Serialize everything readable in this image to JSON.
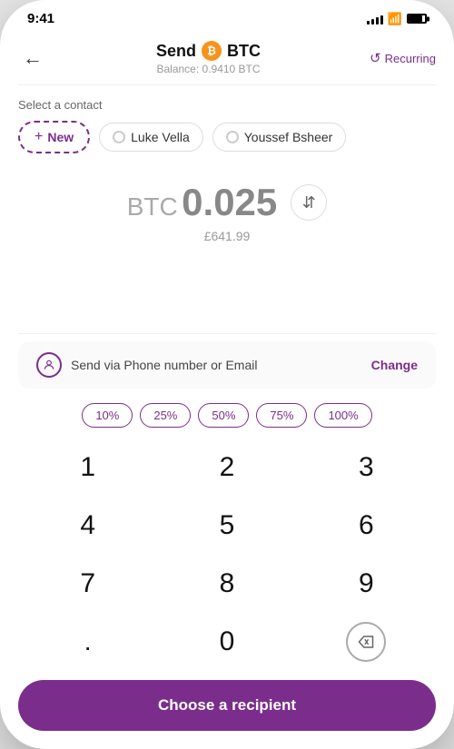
{
  "statusBar": {
    "time": "9:41"
  },
  "header": {
    "title": "Send",
    "currency": "BTC",
    "balance": "Balance: 0.9410 BTC",
    "recurringLabel": "Recurring"
  },
  "contacts": {
    "sectionLabel": "Select a contact",
    "newLabel": "New",
    "items": [
      {
        "name": "Luke Vella"
      },
      {
        "name": "Youssef Bsheer"
      }
    ]
  },
  "amount": {
    "currency": "BTC",
    "value": "0.025",
    "fiat": "£641.99"
  },
  "sendMethod": {
    "text": "Send via Phone number or Email",
    "changeLabel": "Change"
  },
  "percentages": [
    "10%",
    "25%",
    "50%",
    "75%",
    "100%"
  ],
  "keypad": {
    "keys": [
      "1",
      "2",
      "3",
      "4",
      "5",
      "6",
      "7",
      "8",
      "9",
      ".",
      "0",
      "⌫"
    ]
  },
  "cta": {
    "label": "Choose a recipient"
  }
}
